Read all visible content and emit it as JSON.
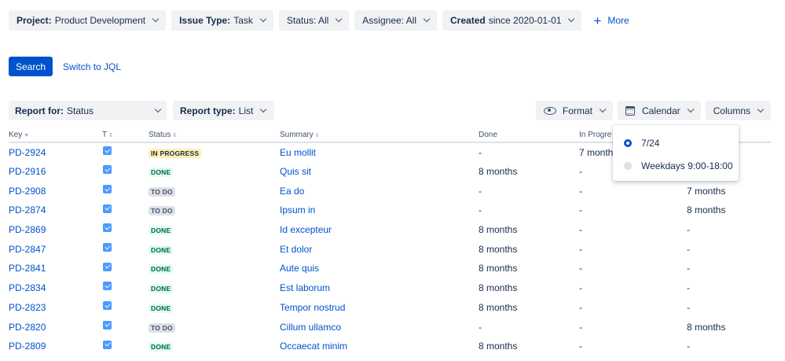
{
  "filters": [
    {
      "label": "Project:",
      "value": "Product Development"
    },
    {
      "label": "Issue Type:",
      "value": "Task"
    },
    {
      "label": "",
      "value": "Status: All"
    },
    {
      "label": "",
      "value": "Assignee: All"
    },
    {
      "label": "Created",
      "value": "since 2020-01-01"
    }
  ],
  "more_label": "More",
  "search_label": "Search",
  "jql_label": "Switch to JQL",
  "report_for": {
    "label": "Report for:",
    "value": "Status"
  },
  "report_type": {
    "label": "Report type:",
    "value": "List"
  },
  "tools": {
    "format": "Format",
    "calendar": "Calendar",
    "columns": "Columns"
  },
  "columns": [
    "Key",
    "T",
    "Status",
    "Summary",
    "Done",
    "In Progre",
    ""
  ],
  "rows": [
    {
      "key": "PD-2924",
      "status": "IN PROGRESS",
      "status_kind": "inprogress",
      "summary": "Eu mollit",
      "done": "-",
      "inprog": "7 month",
      "todo": ""
    },
    {
      "key": "PD-2916",
      "status": "DONE",
      "status_kind": "done",
      "summary": "Quis sit",
      "done": "8 months",
      "inprog": "-",
      "todo": ""
    },
    {
      "key": "PD-2908",
      "status": "TO DO",
      "status_kind": "todo",
      "summary": "Ea do",
      "done": "-",
      "inprog": "-",
      "todo": "7 months"
    },
    {
      "key": "PD-2874",
      "status": "TO DO",
      "status_kind": "todo",
      "summary": "Ipsum in",
      "done": "-",
      "inprog": "-",
      "todo": "8 months"
    },
    {
      "key": "PD-2869",
      "status": "DONE",
      "status_kind": "done",
      "summary": "Id excepteur",
      "done": "8 months",
      "inprog": "-",
      "todo": "-"
    },
    {
      "key": "PD-2847",
      "status": "DONE",
      "status_kind": "done",
      "summary": "Et dolor",
      "done": "8 months",
      "inprog": "-",
      "todo": "-"
    },
    {
      "key": "PD-2841",
      "status": "DONE",
      "status_kind": "done",
      "summary": "Aute quis",
      "done": "8 months",
      "inprog": "-",
      "todo": "-"
    },
    {
      "key": "PD-2834",
      "status": "DONE",
      "status_kind": "done",
      "summary": "Est laborum",
      "done": "8 months",
      "inprog": "-",
      "todo": "-"
    },
    {
      "key": "PD-2823",
      "status": "DONE",
      "status_kind": "done",
      "summary": "Tempor nostrud",
      "done": "8 months",
      "inprog": "-",
      "todo": "-"
    },
    {
      "key": "PD-2820",
      "status": "TO DO",
      "status_kind": "todo",
      "summary": "Cillum ullamco",
      "done": "-",
      "inprog": "-",
      "todo": "8 months"
    },
    {
      "key": "PD-2809",
      "status": "DONE",
      "status_kind": "done",
      "summary": "Occaecat minim",
      "done": "8 months",
      "inprog": "-",
      "todo": "-"
    }
  ],
  "calendar_menu": [
    {
      "label": "7/24",
      "selected": true
    },
    {
      "label": "Weekdays 9:00-18:00",
      "selected": false
    }
  ],
  "colors": {
    "accent": "#0052cc",
    "checkbox": "#4c9aff",
    "inprogress_bg": "#fff0b3",
    "done_bg": "#e3fcef",
    "todo_bg": "#dfe1e6"
  }
}
